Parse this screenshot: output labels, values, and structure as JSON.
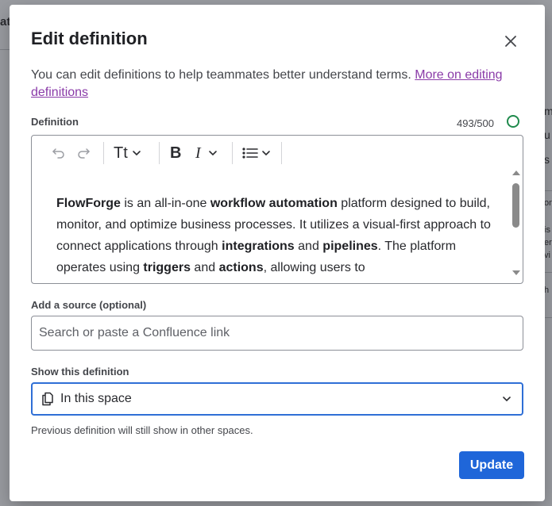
{
  "modal": {
    "title": "Edit definition",
    "intro_text": "You can edit definitions to help teammates better understand terms. ",
    "intro_link": "More on editing definitions"
  },
  "definition": {
    "label": "Definition",
    "counter": "493/500",
    "content": [
      {
        "text": "FlowForge",
        "bold": true
      },
      {
        "text": " is an all-in-one ",
        "bold": false
      },
      {
        "text": "workflow automation",
        "bold": true
      },
      {
        "text": " platform designed to build, monitor, and optimize business processes. It utilizes a visual-first approach to connect applications through ",
        "bold": false
      },
      {
        "text": "integrations",
        "bold": true
      },
      {
        "text": " and ",
        "bold": false
      },
      {
        "text": "pipelines",
        "bold": true
      },
      {
        "text": ". The platform operates using ",
        "bold": false
      },
      {
        "text": "triggers",
        "bold": true
      },
      {
        "text": " and ",
        "bold": false
      },
      {
        "text": "actions",
        "bold": true
      },
      {
        "text": ", allowing users to",
        "bold": false
      }
    ],
    "toolbar": {
      "text_style_label": "Tt",
      "bold_label": "B",
      "italic_label": "I"
    }
  },
  "source": {
    "label": "Add a source (optional)",
    "placeholder": "Search or paste a Confluence link",
    "value": ""
  },
  "visibility": {
    "label": "Show this definition",
    "selected": "In this space",
    "helper": "Previous definition will still show in other spaces."
  },
  "actions": {
    "update_label": "Update"
  },
  "colors": {
    "primary": "#1f66d9",
    "link": "#8a3ba8",
    "counter_ring": "#1f8a4c",
    "focus_border": "#2f6fd6"
  }
}
